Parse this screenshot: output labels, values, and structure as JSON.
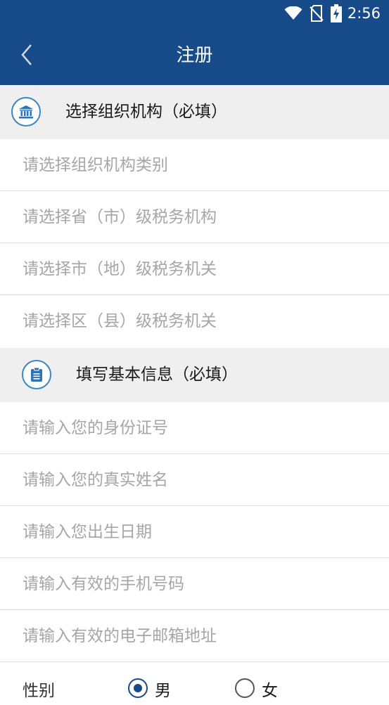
{
  "status_bar": {
    "time": "2:56",
    "icons": [
      "wifi-icon",
      "no-sim-icon",
      "battery-charging-icon"
    ]
  },
  "app_bar": {
    "back_icon": "chevron-left-icon",
    "title": "注册"
  },
  "organization_section": {
    "icon": "bank-building-icon",
    "title": "选择组织机构（必填）",
    "fields": [
      {
        "placeholder": "请选择组织机构类别",
        "value": ""
      },
      {
        "placeholder": "请选择省（市）级税务机构",
        "value": ""
      },
      {
        "placeholder": "请选择市（地）级税务机关",
        "value": ""
      },
      {
        "placeholder": "请选择区（县）级税务机关",
        "value": ""
      }
    ]
  },
  "basic_info_section": {
    "icon": "clipboard-icon",
    "title": "填写基本信息（必填）",
    "fields": [
      {
        "placeholder": "请输入您的身份证号",
        "value": ""
      },
      {
        "placeholder": "请输入您的真实姓名",
        "value": ""
      },
      {
        "placeholder": "请输入您出生日期",
        "value": ""
      },
      {
        "placeholder": "请输入有效的手机号码",
        "value": ""
      },
      {
        "placeholder": "请输入有效的电子邮箱地址",
        "value": ""
      }
    ]
  },
  "gender": {
    "label": "性别",
    "options": [
      {
        "label": "男",
        "selected": true
      },
      {
        "label": "女",
        "selected": false
      }
    ]
  },
  "colors": {
    "header": "#164a89",
    "section_bg": "#efefef",
    "icon_ring": "#3b86c4",
    "placeholder": "#a6a6a6"
  }
}
